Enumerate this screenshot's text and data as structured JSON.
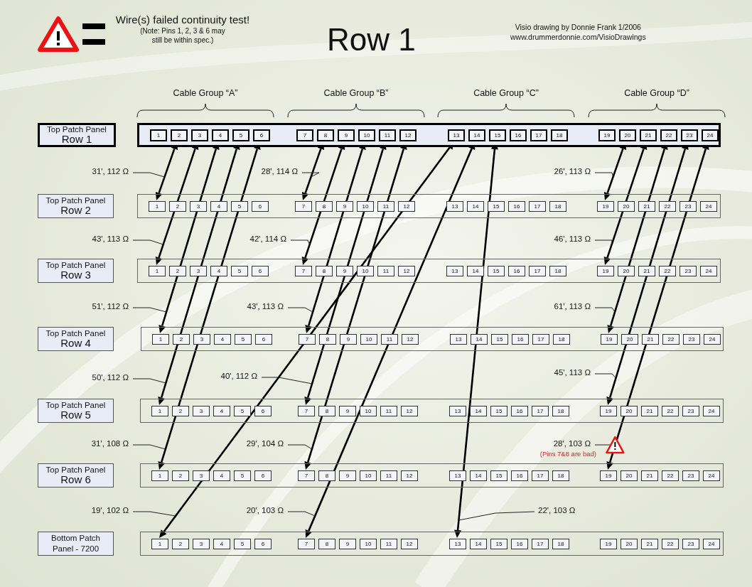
{
  "legend": {
    "title": "Wire(s) failed continuity test!",
    "note": "(Note: Pins 1, 2, 3 & 6 may still be within spec.)"
  },
  "title": "Row 1",
  "credit": [
    "Visio drawing by Donnie Frank 1/2006",
    "www.drummerdonnie.com/VisioDrawings"
  ],
  "cable_groups": [
    "Cable Group “A”",
    "Cable Group “B”",
    "Cable Group “C”",
    "Cable Group “D”"
  ],
  "panels": [
    {
      "name": "Top Patch Panel",
      "row": "Row 1",
      "highlighted": true,
      "ports": [
        "1",
        "2",
        "3",
        "4",
        "5",
        "6",
        "7",
        "8",
        "9",
        "10",
        "11",
        "12",
        "13",
        "14",
        "15",
        "16",
        "17",
        "18",
        "19",
        "20",
        "21",
        "22",
        "23",
        "24"
      ]
    },
    {
      "name": "Top Patch Panel",
      "row": "Row 2",
      "highlighted": false,
      "ports": [
        "1",
        "2",
        "3",
        "4",
        "5",
        "6",
        "7",
        "8",
        "9",
        "10",
        "11",
        "12",
        "13",
        "14",
        "15",
        "16",
        "17",
        "18",
        "19",
        "20",
        "21",
        "22",
        "23",
        "24"
      ]
    },
    {
      "name": "Top Patch Panel",
      "row": "Row 3",
      "highlighted": false,
      "ports": [
        "1",
        "2",
        "3",
        "4",
        "5",
        "6",
        "7",
        "8",
        "9",
        "10",
        "11",
        "12",
        "13",
        "14",
        "15",
        "16",
        "17",
        "18",
        "19",
        "20",
        "21",
        "22",
        "23",
        "24"
      ]
    },
    {
      "name": "Top Patch Panel",
      "row": "Row 4",
      "highlighted": false,
      "ports": [
        "1",
        "2",
        "3",
        "4",
        "5",
        "6",
        "7",
        "8",
        "9",
        "10",
        "11",
        "12",
        "13",
        "14",
        "15",
        "16",
        "17",
        "18",
        "19",
        "20",
        "21",
        "22",
        "23",
        "24"
      ]
    },
    {
      "name": "Top Patch Panel",
      "row": "Row 5",
      "highlighted": false,
      "ports": [
        "1",
        "2",
        "3",
        "4",
        "5",
        "6",
        "7",
        "8",
        "9",
        "10",
        "11",
        "12",
        "13",
        "14",
        "15",
        "16",
        "17",
        "18",
        "19",
        "20",
        "21",
        "22",
        "23",
        "24"
      ]
    },
    {
      "name": "Top Patch Panel",
      "row": "Row 6",
      "highlighted": false,
      "ports": [
        "1",
        "2",
        "3",
        "4",
        "5",
        "6",
        "7",
        "8",
        "9",
        "10",
        "11",
        "12",
        "13",
        "14",
        "15",
        "16",
        "17",
        "18",
        "19",
        "20",
        "21",
        "22",
        "23",
        "24"
      ]
    },
    {
      "name": "Bottom Patch Panel - 7200",
      "highlighted": false,
      "ports": [
        "1",
        "2",
        "3",
        "4",
        "5",
        "6",
        "7",
        "8",
        "9",
        "10",
        "11",
        "12",
        "13",
        "14",
        "15",
        "16",
        "17",
        "18",
        "19",
        "20",
        "21",
        "22",
        "23",
        "24"
      ]
    }
  ],
  "cables": [
    {
      "reading": "31', 112 Ω",
      "failed": false
    },
    {
      "reading": "28', 114 Ω",
      "failed": false
    },
    {
      "reading": "26', 113 Ω",
      "failed": false
    },
    {
      "reading": "43', 113 Ω",
      "failed": false
    },
    {
      "reading": "42', 114 Ω",
      "failed": false
    },
    {
      "reading": "46', 113 Ω",
      "failed": false
    },
    {
      "reading": "51', 112 Ω",
      "failed": false
    },
    {
      "reading": "43', 113 Ω",
      "failed": false
    },
    {
      "reading": "61', 113 Ω",
      "failed": false
    },
    {
      "reading": "50', 112 Ω",
      "failed": false
    },
    {
      "reading": "40', 112 Ω",
      "failed": false
    },
    {
      "reading": "45', 113 Ω",
      "failed": false
    },
    {
      "reading": "31', 108 Ω",
      "failed": false
    },
    {
      "reading": "29', 104 Ω",
      "failed": false
    },
    {
      "reading": "28', 103 Ω",
      "failed": true,
      "note": "(Pins 7&8 are bad)"
    },
    {
      "reading": "19', 102 Ω",
      "failed": false
    },
    {
      "reading": "20', 103 Ω",
      "failed": false
    },
    {
      "reading": "22', 103 Ω",
      "failed": false
    }
  ]
}
